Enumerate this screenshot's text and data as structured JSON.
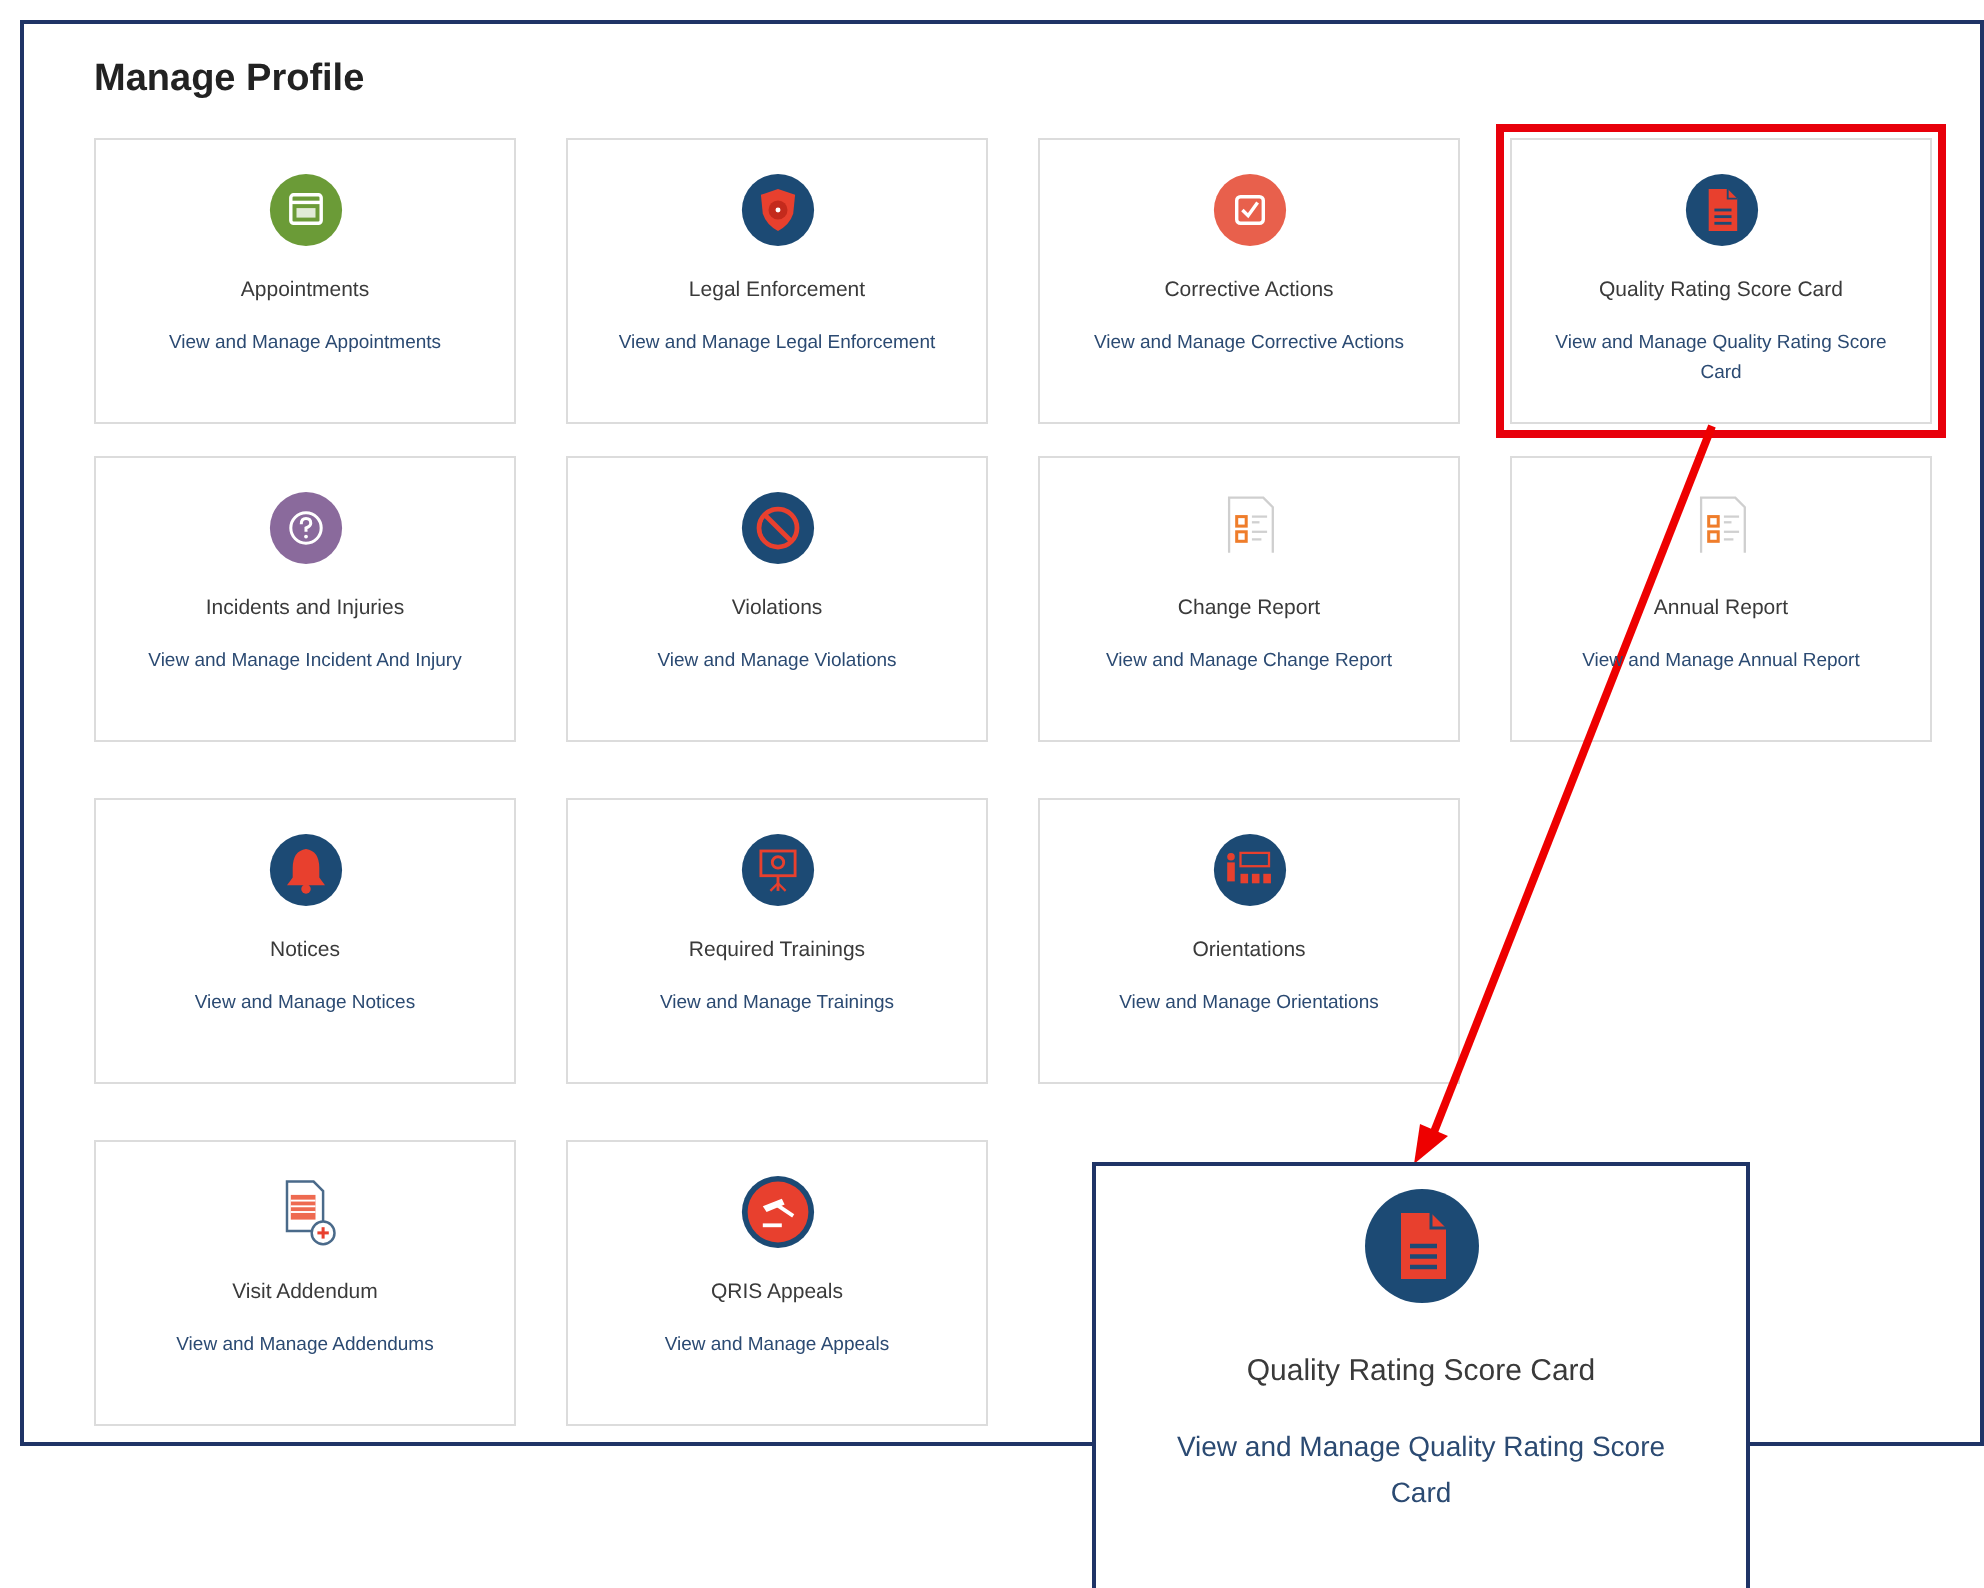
{
  "page_title": "Manage Profile",
  "rows": [
    {
      "cards": [
        {
          "kind": "calendar",
          "title": "Appointments",
          "description": "View and Manage Appointments",
          "highlighted": false
        },
        {
          "kind": "shield",
          "title": "Legal Enforcement",
          "description": "View and Manage Legal Enforcement",
          "highlighted": false
        },
        {
          "kind": "checkbox",
          "title": "Corrective Actions",
          "description": "View and Manage Corrective Actions",
          "highlighted": false
        },
        {
          "kind": "scorecard",
          "title": "Quality Rating Score Card",
          "description": "View and Manage Quality Rating Score Card",
          "highlighted": true
        }
      ]
    },
    {
      "cards": [
        {
          "kind": "question",
          "title": "Incidents and Injuries",
          "description": "View and Manage Incident And Injury",
          "highlighted": false
        },
        {
          "kind": "prohibited",
          "title": "Violations",
          "description": "View and Manage Violations",
          "highlighted": false
        },
        {
          "kind": "report",
          "title": "Change Report",
          "description": "View and Manage Change Report",
          "highlighted": false
        },
        {
          "kind": "report",
          "title": "Annual Report",
          "description": "View and Manage Annual Report",
          "highlighted": false
        }
      ]
    },
    {
      "cards": [
        {
          "kind": "bell",
          "title": "Notices",
          "description": "View and Manage Notices",
          "highlighted": false
        },
        {
          "kind": "easel",
          "title": "Required Trainings",
          "description": "View and Manage Trainings",
          "highlighted": false
        },
        {
          "kind": "orientation",
          "title": "Orientations",
          "description": "View and Manage Orientations",
          "highlighted": false
        }
      ]
    },
    {
      "cards": [
        {
          "kind": "addendum",
          "title": "Visit Addendum",
          "description": "View and Manage Addendums",
          "highlighted": false
        },
        {
          "kind": "gavel",
          "title": "QRIS Appeals",
          "description": "View and Manage Appeals",
          "highlighted": false
        }
      ]
    }
  ],
  "callout": {
    "kind": "scorecard",
    "title": "Quality Rating Score Card",
    "description": "View and Manage Quality Rating Score Card"
  }
}
